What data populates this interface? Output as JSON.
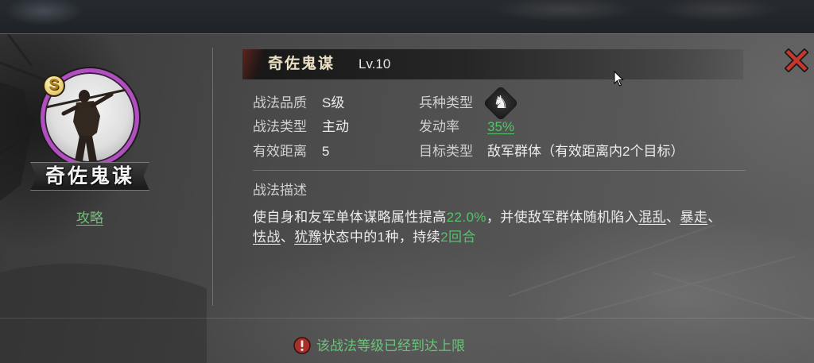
{
  "skill": {
    "grade_badge": "S",
    "name_banner": "奇佐鬼谋",
    "guide_link": "攻略",
    "title": "奇佐鬼谋",
    "level": "Lv.10"
  },
  "attributes": {
    "quality": {
      "label": "战法品质",
      "value": "S级"
    },
    "skill_type": {
      "label": "战法类型",
      "value": "主动"
    },
    "range": {
      "label": "有效距离",
      "value": "5"
    },
    "troop_type": {
      "label": "兵种类型",
      "icon": "horse-head-icon"
    },
    "trigger_rate": {
      "label": "发动率",
      "value": "35%"
    },
    "target_type": {
      "label": "目标类型",
      "value": "敌军群体（有效距离内2个目标）"
    }
  },
  "description": {
    "heading": "战法描述",
    "line1": [
      "使自身和友军单体谋略属性提高",
      "22.0%",
      "，并使敌军群体随机陷入",
      "混乱",
      "、",
      "暴走",
      "、"
    ],
    "line2": [
      "怯战",
      "、",
      "犹豫",
      "状态中的1种，持续",
      "2回合"
    ]
  },
  "footer": {
    "icon": "warning-icon",
    "notice": "该战法等级已经到达上限"
  },
  "icons": {
    "close": "close-icon",
    "cursor": "mouse-cursor-icon",
    "portrait": "warrior-portrait-icon"
  },
  "colors": {
    "accent_green": "#55c46b",
    "portrait_ring": "#b24fc0",
    "close_red": "#c8362c",
    "label_gray": "#cfcfcf",
    "value_white": "#ececec"
  }
}
